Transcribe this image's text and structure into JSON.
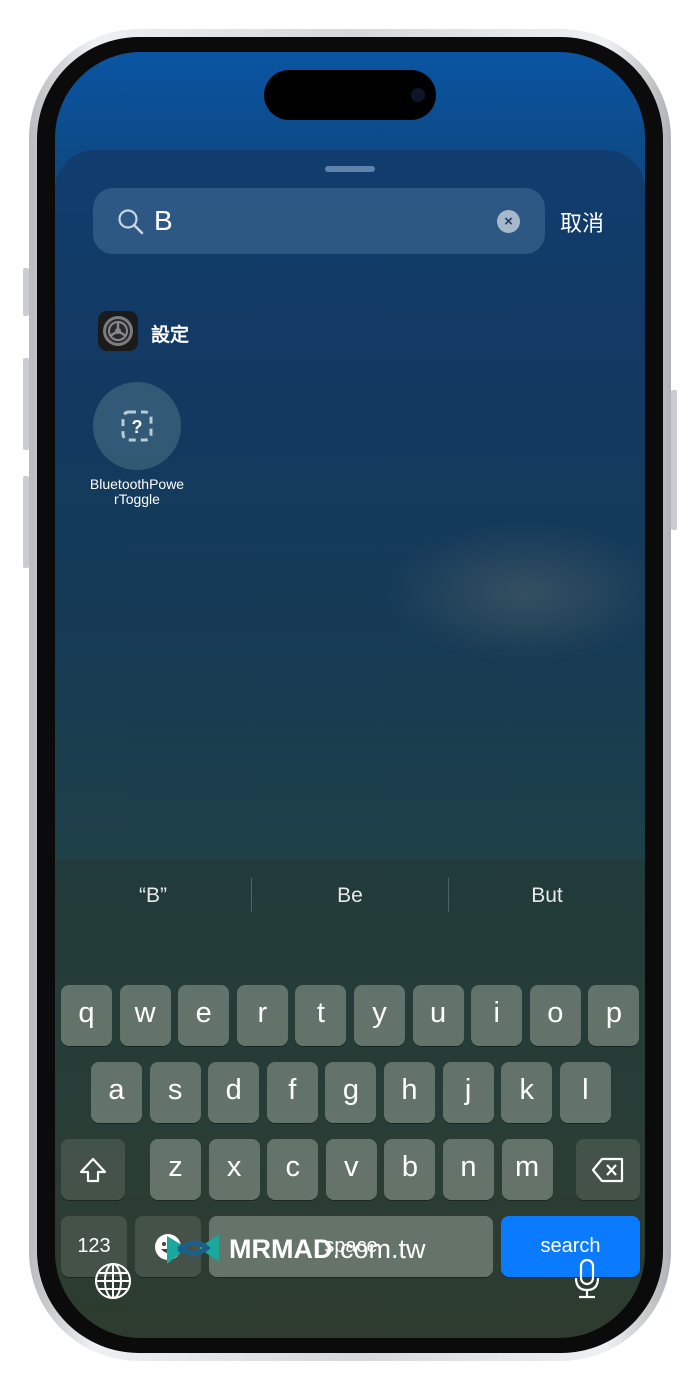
{
  "search": {
    "query": "B",
    "cancel_label": "取消"
  },
  "results": [
    {
      "label": "設定",
      "icon": "settings-gear-icon"
    },
    {
      "label_line1": "BluetoothPowe",
      "label_line2": "rToggle",
      "icon": "shortcut-placeholder-icon"
    }
  ],
  "keyboard": {
    "suggestions": [
      "“B”",
      "Be",
      "But"
    ],
    "row1": [
      "q",
      "w",
      "e",
      "r",
      "t",
      "y",
      "u",
      "i",
      "o",
      "p"
    ],
    "row2": [
      "a",
      "s",
      "d",
      "f",
      "g",
      "h",
      "j",
      "k",
      "l"
    ],
    "row3": [
      "z",
      "x",
      "c",
      "v",
      "b",
      "n",
      "m"
    ],
    "numbers_label": "123",
    "space_label": "space",
    "search_label": "search",
    "accent_color": "#0a7aff"
  },
  "watermark": "MRMAD.com.tw"
}
